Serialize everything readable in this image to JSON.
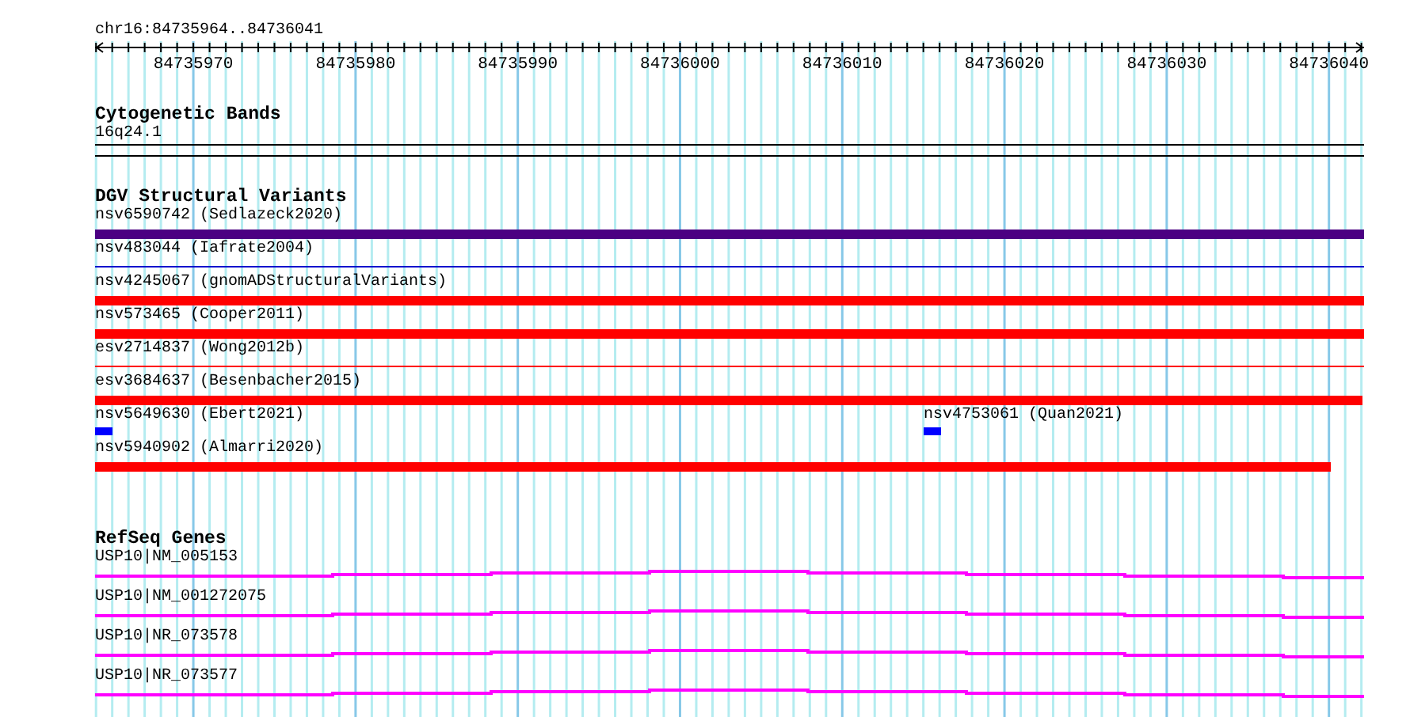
{
  "location": "chr16:84735964..84736041",
  "ruler": {
    "ticks": [
      "84735970",
      "84735980",
      "84735990",
      "84736000",
      "84736010",
      "84736020",
      "84736030",
      "84736040"
    ]
  },
  "cytobands": {
    "title": "Cytogenetic Bands",
    "features": [
      {
        "label": "16q24.1"
      }
    ]
  },
  "variants": {
    "title": "DGV Structural Variants",
    "features": [
      {
        "label": "nsv6590742 (Sedlazeck2020)",
        "kind": "bar",
        "color": "#4b0082"
      },
      {
        "label": "nsv483044 (Iafrate2004)",
        "kind": "line",
        "color": "#0000cd"
      },
      {
        "label": "nsv4245067 (gnomADStructuralVariants)",
        "kind": "bar",
        "color": "#ff0000"
      },
      {
        "label": "nsv573465 (Cooper2011)",
        "kind": "bar",
        "color": "#ff0000"
      },
      {
        "label": "esv2714837 (Wong2012b)",
        "kind": "line",
        "color": "#ff0000"
      },
      {
        "label": "esv3684637 (Besenbacher2015)",
        "kind": "bar",
        "color": "#ff0000"
      },
      {
        "label": "nsv5649630 (Ebert2021)",
        "kind": "block",
        "color": "#0000ff"
      },
      {
        "label": "nsv4753061 (Quan2021)",
        "kind": "block",
        "color": "#0000ff"
      },
      {
        "label": "nsv5940902 (Almarri2020)",
        "kind": "bar",
        "color": "#ff0000"
      }
    ]
  },
  "genes": {
    "title": "RefSeq Genes",
    "features": [
      {
        "label": "USP10|NM_005153"
      },
      {
        "label": "USP10|NM_001272075"
      },
      {
        "label": "USP10|NR_073578"
      },
      {
        "label": "USP10|NR_073577"
      }
    ]
  }
}
